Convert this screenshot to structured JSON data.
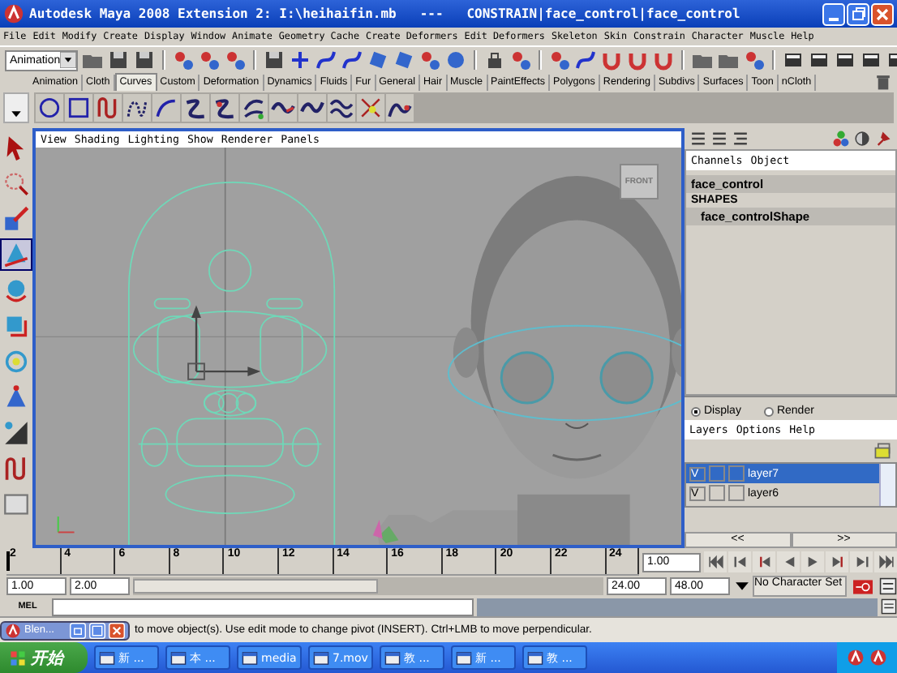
{
  "window": {
    "title": "Autodesk Maya 2008 Extension 2: I:\\heihaifin.mb   ---   CONSTRAIN|face_control|face_control"
  },
  "menu_bar": [
    "File",
    "Edit",
    "Modify",
    "Create",
    "Display",
    "Window",
    "Animate",
    "Geometry Cache",
    "Create Deformers",
    "Edit Deformers",
    "Skeleton",
    "Skin",
    "Constrain",
    "Character",
    "Muscle",
    "Help"
  ],
  "status_line": {
    "menu_set": "Animation"
  },
  "shelf_tabs": [
    {
      "label": "Animation",
      "selected": false
    },
    {
      "label": "Cloth",
      "selected": false
    },
    {
      "label": "Curves",
      "selected": true
    },
    {
      "label": "Custom",
      "selected": false
    },
    {
      "label": "Deformation",
      "selected": false
    },
    {
      "label": "Dynamics",
      "selected": false
    },
    {
      "label": "Fluids",
      "selected": false
    },
    {
      "label": "Fur",
      "selected": false
    },
    {
      "label": "General",
      "selected": false
    },
    {
      "label": "Hair",
      "selected": false
    },
    {
      "label": "Muscle",
      "selected": false
    },
    {
      "label": "PaintEffects",
      "selected": false
    },
    {
      "label": "Polygons",
      "selected": false
    },
    {
      "label": "Rendering",
      "selected": false
    },
    {
      "label": "Subdivs",
      "selected": false
    },
    {
      "label": "Surfaces",
      "selected": false
    },
    {
      "label": "Toon",
      "selected": false
    },
    {
      "label": "nCloth",
      "selected": false
    }
  ],
  "viewport": {
    "menus": [
      "View",
      "Shading",
      "Lighting",
      "Show",
      "Renderer",
      "Panels"
    ],
    "view_cube_label": "FRONT"
  },
  "channel_box": {
    "menus": [
      "Channels",
      "Object"
    ],
    "object_name": "face_control",
    "section": "SHAPES",
    "shapes": [
      {
        "label": "face_controlShape",
        "selected": true
      }
    ]
  },
  "layer_editor": {
    "modes": [
      {
        "label": "Display",
        "selected": true
      },
      {
        "label": "Render",
        "selected": false
      }
    ],
    "menus": [
      "Layers",
      "Options",
      "Help"
    ],
    "layers": [
      {
        "visibility": "V",
        "name": "layer7",
        "selected": true
      },
      {
        "visibility": "V",
        "name": "layer6",
        "selected": false
      }
    ],
    "page_buttons": [
      "<<",
      ">>"
    ]
  },
  "time_slider": {
    "level": 0,
    "ticks": [
      "2",
      "4",
      "6",
      "8",
      "10",
      "12",
      "14",
      "16",
      "18",
      "20",
      "22",
      "24"
    ],
    "current_frame": "1.00"
  },
  "range_slider": {
    "start": "1.00",
    "range_start": "2.00",
    "range_end": "24.00",
    "end": "48.00",
    "character_set": "No Character Set",
    "level": 0.52
  },
  "command_line": {
    "label": "MEL"
  },
  "help_line": {
    "text": "to move object(s). Use edit mode to change pivot (INSERT).  Ctrl+LMB to move perpendicular."
  },
  "minimized_window": {
    "title": "Blen..."
  },
  "taskbar": {
    "start": "开始",
    "items": [
      "新 ...",
      "本 ...",
      "media",
      "7.mov",
      "教 ...",
      "新 ...",
      "教 ..."
    ]
  }
}
